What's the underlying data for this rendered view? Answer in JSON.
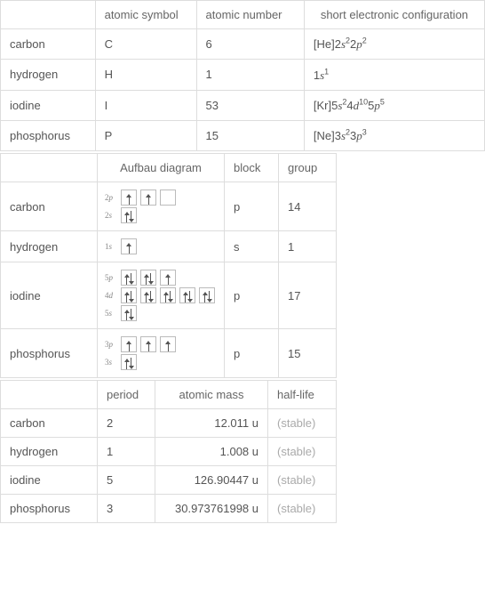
{
  "table1": {
    "headers": [
      "",
      "atomic symbol",
      "atomic number",
      "short electronic configuration"
    ],
    "rows": [
      {
        "name": "carbon",
        "symbol": "C",
        "num": "6",
        "config": {
          "prefix": "[He]",
          "parts": [
            [
              "2",
              "s",
              "2"
            ],
            [
              "2",
              "p",
              "2"
            ]
          ]
        }
      },
      {
        "name": "hydrogen",
        "symbol": "H",
        "num": "1",
        "config": {
          "prefix": "",
          "parts": [
            [
              "1",
              "s",
              "1"
            ]
          ]
        }
      },
      {
        "name": "iodine",
        "symbol": "I",
        "num": "53",
        "config": {
          "prefix": "[Kr]",
          "parts": [
            [
              "5",
              "s",
              "2"
            ],
            [
              "4",
              "d",
              "10"
            ],
            [
              "5",
              "p",
              "5"
            ]
          ]
        }
      },
      {
        "name": "phosphorus",
        "symbol": "P",
        "num": "15",
        "config": {
          "prefix": "[Ne]",
          "parts": [
            [
              "3",
              "s",
              "2"
            ],
            [
              "3",
              "p",
              "3"
            ]
          ]
        }
      }
    ]
  },
  "table2": {
    "headers": [
      "",
      "Aufbau diagram",
      "block",
      "group"
    ],
    "rows": [
      {
        "name": "carbon",
        "block": "p",
        "group": "14",
        "orbitals": [
          {
            "label": "2p",
            "boxes": [
              [
                "up"
              ],
              [
                "up"
              ],
              []
            ]
          },
          {
            "label": "2s",
            "boxes": [
              [
                "up",
                "down"
              ]
            ]
          }
        ]
      },
      {
        "name": "hydrogen",
        "block": "s",
        "group": "1",
        "orbitals": [
          {
            "label": "1s",
            "boxes": [
              [
                "up"
              ]
            ]
          }
        ]
      },
      {
        "name": "iodine",
        "block": "p",
        "group": "17",
        "orbitals": [
          {
            "label": "5p",
            "boxes": [
              [
                "up",
                "down"
              ],
              [
                "up",
                "down"
              ],
              [
                "up"
              ]
            ]
          },
          {
            "label": "4d",
            "boxes": [
              [
                "up",
                "down"
              ],
              [
                "up",
                "down"
              ],
              [
                "up",
                "down"
              ],
              [
                "up",
                "down"
              ],
              [
                "up",
                "down"
              ]
            ]
          },
          {
            "label": "5s",
            "boxes": [
              [
                "up",
                "down"
              ]
            ]
          }
        ]
      },
      {
        "name": "phosphorus",
        "block": "p",
        "group": "15",
        "orbitals": [
          {
            "label": "3p",
            "boxes": [
              [
                "up"
              ],
              [
                "up"
              ],
              [
                "up"
              ]
            ]
          },
          {
            "label": "3s",
            "boxes": [
              [
                "up",
                "down"
              ]
            ]
          }
        ]
      }
    ]
  },
  "table3": {
    "headers": [
      "",
      "period",
      "atomic mass",
      "half-life"
    ],
    "rows": [
      {
        "name": "carbon",
        "period": "2",
        "mass": "12.011 u",
        "half": "(stable)"
      },
      {
        "name": "hydrogen",
        "period": "1",
        "mass": "1.008 u",
        "half": "(stable)"
      },
      {
        "name": "iodine",
        "period": "5",
        "mass": "126.90447 u",
        "half": "(stable)"
      },
      {
        "name": "phosphorus",
        "period": "3",
        "mass": "30.973761998 u",
        "half": "(stable)"
      }
    ]
  }
}
